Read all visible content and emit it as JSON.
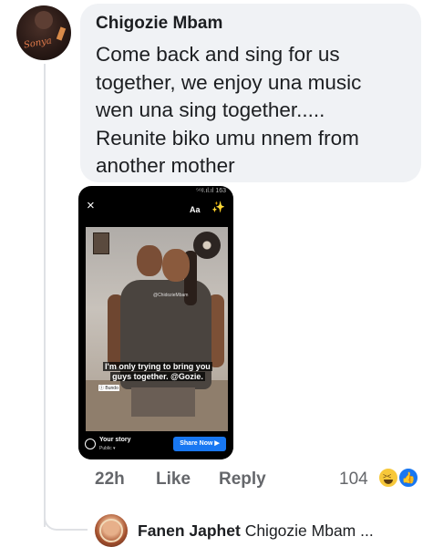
{
  "comment": {
    "author": "Chigozie Mbam",
    "text": "Come back and sing for us\ntogether, we enjoy una music\nwen una sing together.....\nReunite biko umu nnem from\nanother mother",
    "avatar_signature": "Sonya",
    "actions": {
      "time": "22h",
      "like": "Like",
      "reply": "Reply"
    },
    "reactions": {
      "count": "104",
      "icons": [
        "haha-icon",
        "like-icon"
      ]
    }
  },
  "attachment": {
    "story_caption": "I'm only trying to bring you guys together. @Gozie.",
    "toolbar": {
      "close": "×",
      "text_tool": "Aa",
      "effects": "✨"
    },
    "status": "⁵⁶ᵍ.ıl.ıl 163",
    "watermark_top": "@ChidozieMbam",
    "watermark_bottom": "Ⓘ Bundo",
    "story_label": "Your story",
    "privacy": "Public ▾",
    "share_button": "Share Now ▶"
  },
  "reply": {
    "author": "Fanen Japhet",
    "preview": "Chigozie Mbam ..."
  },
  "colors": {
    "bubble": "#f0f2f5",
    "meta_text": "#65676b",
    "share_blue": "#1877f2"
  }
}
